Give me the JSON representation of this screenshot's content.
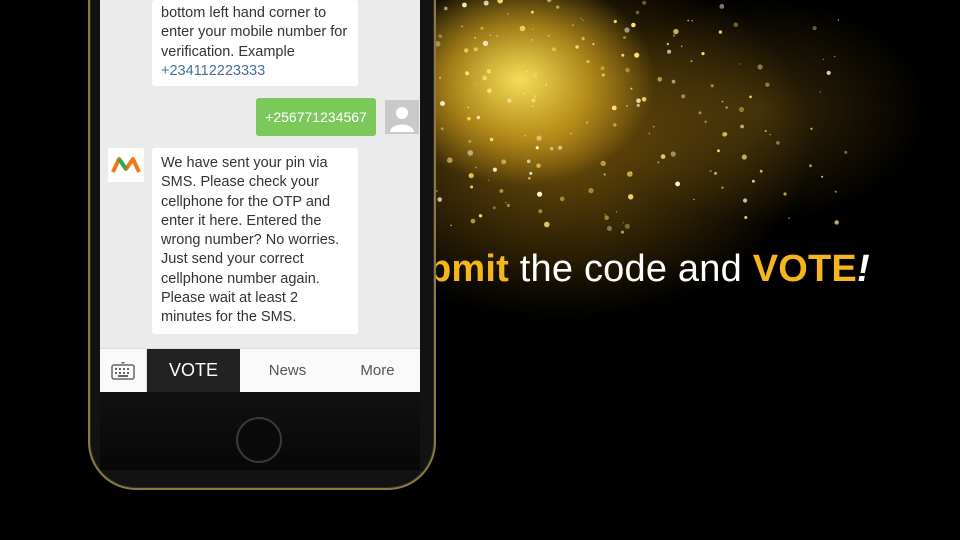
{
  "tagline": {
    "part1": "bmit",
    "part2": " the code and ",
    "part3": "VOTE",
    "part4": "!"
  },
  "chat": {
    "messages": [
      {
        "sender": "bot",
        "lines": [
          "bottom left hand corner to",
          "enter your mobile number for",
          "verification. Example"
        ],
        "link": "+234112223333"
      },
      {
        "sender": "user",
        "text": "+256771234567"
      },
      {
        "sender": "bot",
        "lines": [
          "We have sent your pin via",
          "SMS. Please check your",
          "cellphone for the OTP and",
          "enter it here. Entered the",
          "wrong number? No worries.",
          "Just send your correct",
          "cellphone number again.",
          "Please wait at least 2",
          "minutes for the SMS."
        ]
      }
    ]
  },
  "tabs": {
    "vote": "VOTE",
    "news": "News",
    "more": "More",
    "active": "vote"
  },
  "icons": {
    "keyboard": "keyboard-icon",
    "avatar": "user-avatar-icon",
    "logo": "brand-logo-icon"
  },
  "colors": {
    "accent_gold": "#f5b51c",
    "user_bubble": "#7cc85a",
    "link": "#4a6f9a",
    "active_tab": "#222222"
  }
}
